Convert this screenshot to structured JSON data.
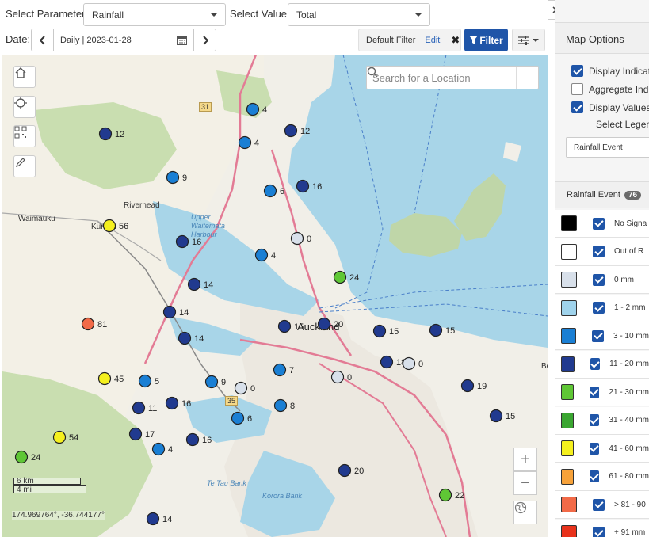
{
  "toolbar": {
    "param_label": "Select Parameter:",
    "param_value": "Rainfall",
    "value_label": "Select Value:",
    "value_value": "Total",
    "date_label": "Date:",
    "date_value": "Daily | 2023-01-28",
    "filter_text": "Default Filter",
    "filter_edit": "Edit",
    "filter_button": "Filter"
  },
  "map": {
    "search_placeholder": "Search for a Location",
    "scale_km": "6 km",
    "scale_mi": "4 mi",
    "coordinates": "174.969764°, -36.744177°",
    "place_labels": [
      "Waimauku",
      "Riverhead",
      "Kumeu",
      "Auckland",
      "Upper Waitemata Harbour",
      "Te Tau Bank",
      "Korora Bank",
      "Be"
    ],
    "road_labels": [
      "31",
      "35",
      "16"
    ],
    "markers": [
      {
        "value": "4",
        "color": "#1a7fd4"
      },
      {
        "value": "12",
        "color": "#213a8f"
      },
      {
        "value": "12",
        "color": "#213a8f"
      },
      {
        "value": "4",
        "color": "#1a7fd4"
      },
      {
        "value": "9",
        "color": "#1a7fd4"
      },
      {
        "value": "6",
        "color": "#1a7fd4"
      },
      {
        "value": "16",
        "color": "#213a8f"
      },
      {
        "value": "56",
        "color": "#f5f01e"
      },
      {
        "value": "16",
        "color": "#213a8f"
      },
      {
        "value": "0",
        "color": "#d8e0ea"
      },
      {
        "value": "4",
        "color": "#1a7fd4"
      },
      {
        "value": "14",
        "color": "#213a8f"
      },
      {
        "value": "24",
        "color": "#5fc735"
      },
      {
        "value": "14",
        "color": "#213a8f"
      },
      {
        "value": "81",
        "color": "#f26a48"
      },
      {
        "value": "15",
        "color": "#213a8f"
      },
      {
        "value": "20",
        "color": "#213a8f"
      },
      {
        "value": "15",
        "color": "#213a8f"
      },
      {
        "value": "15",
        "color": "#213a8f"
      },
      {
        "value": "14",
        "color": "#213a8f"
      },
      {
        "value": "7",
        "color": "#1a7fd4"
      },
      {
        "value": "18",
        "color": "#213a8f"
      },
      {
        "value": "0",
        "color": "#d8e0ea"
      },
      {
        "value": "45",
        "color": "#f5f01e"
      },
      {
        "value": "5",
        "color": "#1a7fd4"
      },
      {
        "value": "9",
        "color": "#1a7fd4"
      },
      {
        "value": "0",
        "color": "#d8e0ea"
      },
      {
        "value": "0",
        "color": "#d8e0ea"
      },
      {
        "value": "19",
        "color": "#213a8f"
      },
      {
        "value": "11",
        "color": "#213a8f"
      },
      {
        "value": "16",
        "color": "#213a8f"
      },
      {
        "value": "8",
        "color": "#1a7fd4"
      },
      {
        "value": "6",
        "color": "#1a7fd4"
      },
      {
        "value": "15",
        "color": "#213a8f"
      },
      {
        "value": "54",
        "color": "#f5f01e"
      },
      {
        "value": "17",
        "color": "#213a8f"
      },
      {
        "value": "4",
        "color": "#1a7fd4"
      },
      {
        "value": "16",
        "color": "#213a8f"
      },
      {
        "value": "24",
        "color": "#5fc735"
      },
      {
        "value": "20",
        "color": "#213a8f"
      },
      {
        "value": "22",
        "color": "#5fc735"
      },
      {
        "value": "14",
        "color": "#213a8f"
      }
    ]
  },
  "panel": {
    "title": "Map Options",
    "options": [
      {
        "label": "Display Indicat",
        "checked": true
      },
      {
        "label": "Aggregate Ind",
        "checked": false
      },
      {
        "label": "Display Values",
        "checked": true
      }
    ],
    "legend_label": "Select Legen",
    "legend_value": "Rainfall Event",
    "events_title": "Rainfall Event",
    "events_count": "76",
    "legend": [
      {
        "color": "#000000",
        "label": "No Signa"
      },
      {
        "color": "#ffffff",
        "label": "Out of R"
      },
      {
        "color": "#d8e0ea",
        "label": "0 mm"
      },
      {
        "color": "#9fd3ec",
        "label": "1 - 2 mm"
      },
      {
        "color": "#1a7fd4",
        "label": "3 - 10 mm"
      },
      {
        "color": "#213a8f",
        "label": "11 - 20 mm"
      },
      {
        "color": "#5fc735",
        "label": "21 - 30 mm"
      },
      {
        "color": "#3aa631",
        "label": "31 - 40 mm"
      },
      {
        "color": "#f5f01e",
        "label": "41 - 60 mm"
      },
      {
        "color": "#f7a23a",
        "label": "61 - 80 mm"
      },
      {
        "color": "#f26a48",
        "label": "> 81 - 90"
      },
      {
        "color": "#e8321b",
        "label": "+ 91 mm"
      }
    ]
  }
}
